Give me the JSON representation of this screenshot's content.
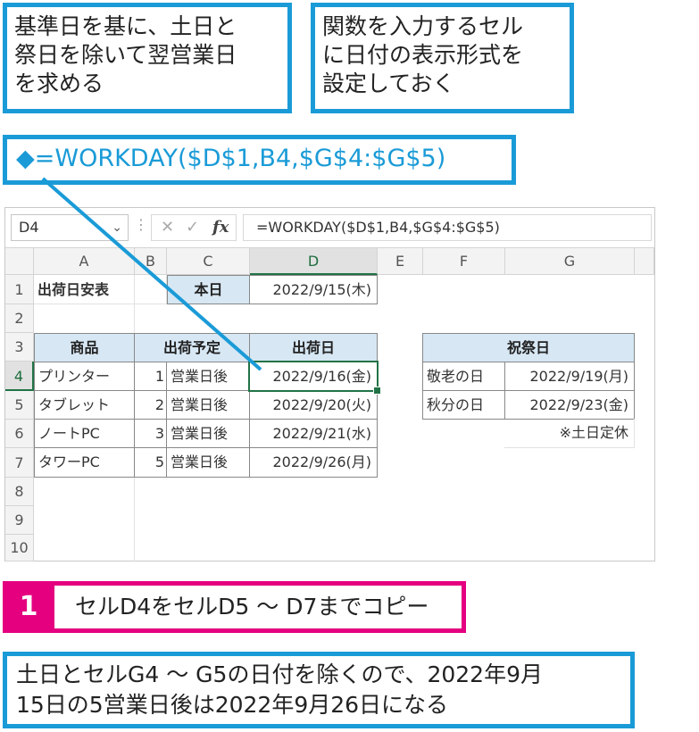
{
  "callouts": {
    "top_left": [
      "基準日を基に、土日と",
      "祭日を除いて翌営業日",
      "を求める"
    ],
    "top_right": [
      "関数を入力するセル",
      "に日付の表示形式を",
      "設定しておく"
    ],
    "formula_diamond": "◆",
    "formula": "=WORKDAY($D$1,B4,$G$4:$G$5)"
  },
  "excel": {
    "name_box": "D4",
    "name_box_arrow": "⌄",
    "separator": "⋮",
    "cancel": "✕",
    "enter": "✓",
    "fx": "fx",
    "formula_bar": "=WORKDAY($D$1,B4,$G$4:$G$5)",
    "columns": [
      "A",
      "B",
      "C",
      "D",
      "E",
      "F",
      "G"
    ],
    "rows": [
      "1",
      "2",
      "3",
      "4",
      "5",
      "6",
      "7",
      "8",
      "9",
      "10"
    ],
    "cells": {
      "A1": "出荷日安表",
      "C1": "本日",
      "D1": "2022/9/15(木)",
      "A3": "商品",
      "B3": "出荷予定",
      "D3": "出荷日",
      "F3": "祝祭日",
      "A4": "プリンター",
      "B4": "1",
      "C4": "営業日後",
      "D4": "2022/9/16(金)",
      "F4": "敬老の日",
      "G4": "2022/9/19(月)",
      "A5": "タブレット",
      "B5": "2",
      "C5": "営業日後",
      "D5": "2022/9/20(火)",
      "F5": "秋分の日",
      "G5": "2022/9/23(金)",
      "A6": "ノートPC",
      "B6": "3",
      "C6": "営業日後",
      "D6": "2022/9/21(水)",
      "G6": "※土日定休",
      "A7": "タワーPC",
      "B7": "5",
      "C7": "営業日後",
      "D7": "2022/9/26(月)"
    }
  },
  "step": {
    "number": "1",
    "text": "セルD4をセルD5 〜 D7までコピー"
  },
  "note": [
    "土日とセルG4 〜 G5の日付を除くので、2022年9月",
    "15日の5営業日後は2022年9月26日になる"
  ],
  "colors": {
    "callout_blue": "#1a9bd7",
    "step_pink": "#e4007f",
    "header_fill": "#d7e7f4",
    "excel_green": "#217346"
  }
}
